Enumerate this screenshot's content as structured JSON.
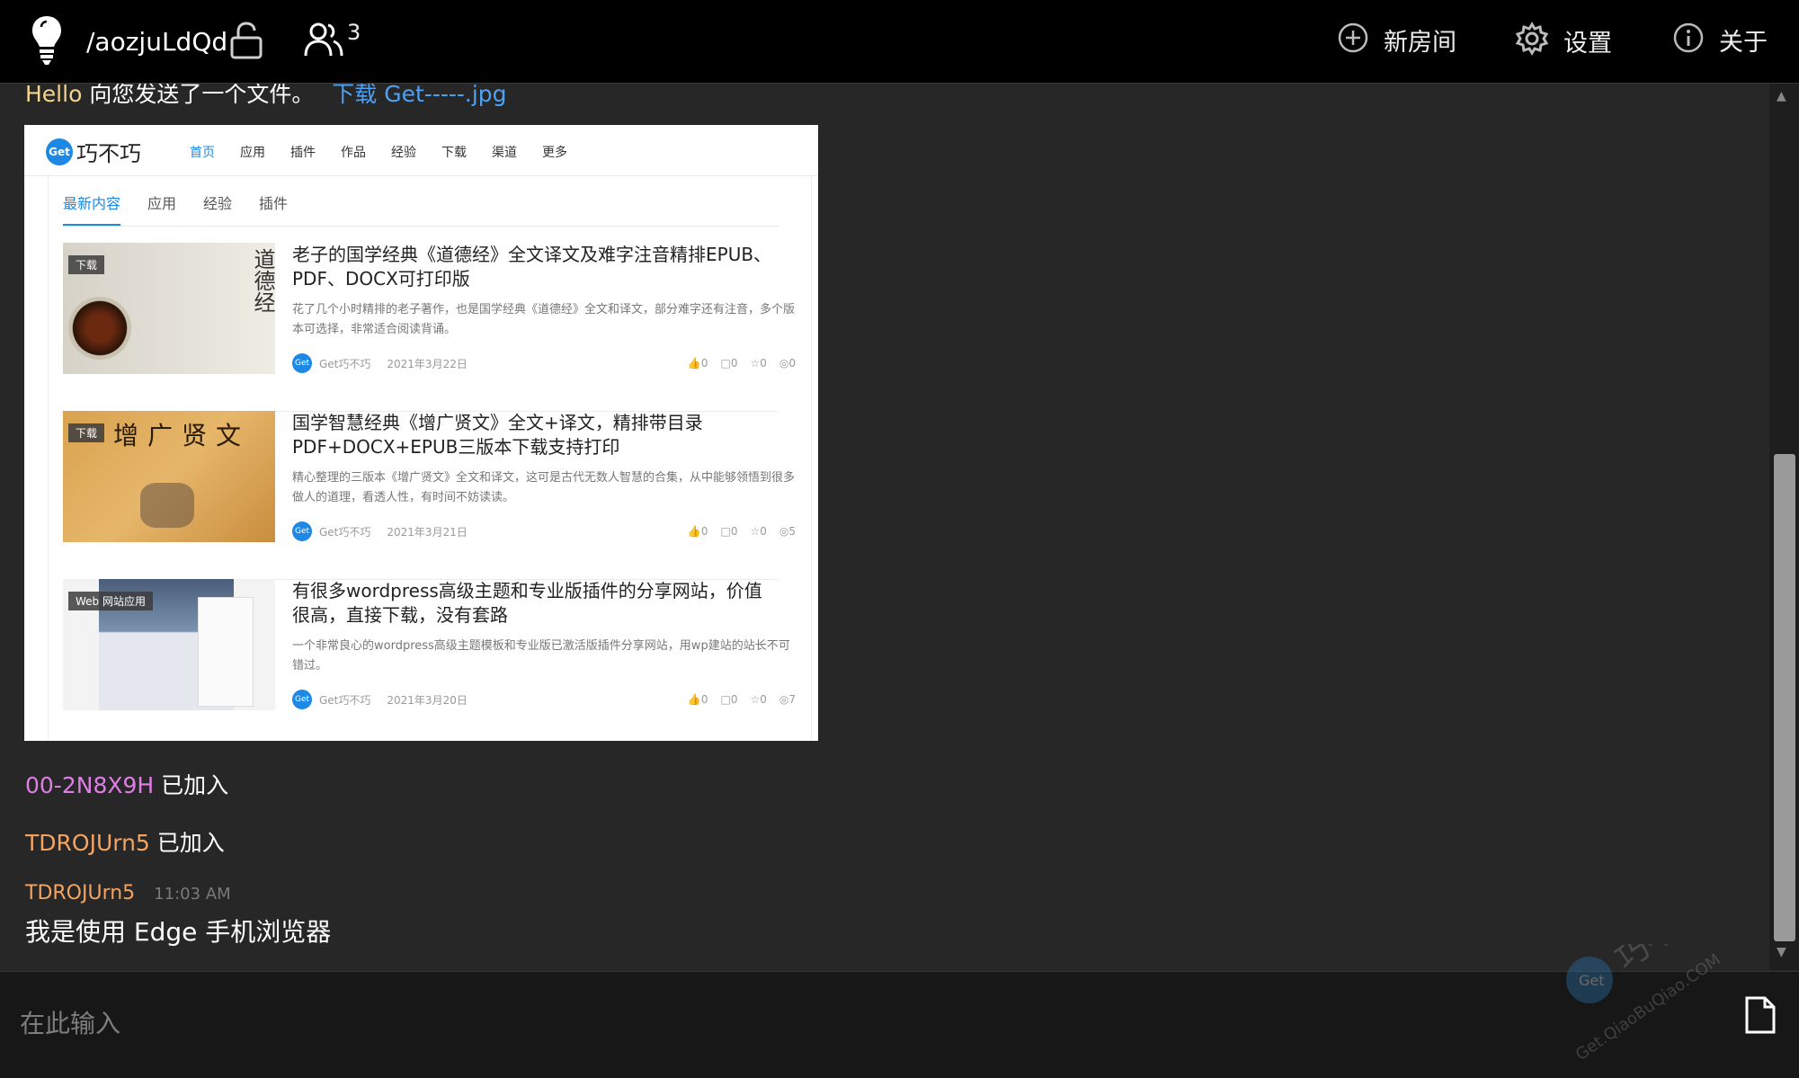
{
  "header": {
    "room_path": "/aozjuLdQd",
    "user_count": "3",
    "nav": {
      "new_room": "新房间",
      "settings": "设置",
      "about": "关于"
    }
  },
  "messages": {
    "file_msg": {
      "sender": "Hello",
      "text": "向您发送了一个文件。",
      "link": "下载 Get-----.jpg"
    },
    "joined_1": {
      "name": "00-2N8X9H",
      "text": "已加入"
    },
    "joined_2": {
      "name": "TDROJUrn5",
      "text": "已加入"
    },
    "chat_1": {
      "sender": "TDROJUrn5",
      "time": "11:03 AM",
      "text": "我是使用 Edge 手机浏览器"
    }
  },
  "shared_image": {
    "logo_badge": "Get",
    "logo_text": "巧不巧",
    "menu": [
      "首页",
      "应用",
      "插件",
      "作品",
      "经验",
      "下载",
      "渠道",
      "更多"
    ],
    "tabs": [
      "最新内容",
      "应用",
      "经验",
      "插件"
    ],
    "articles": [
      {
        "tag": "下载",
        "thumb_text": "道德经",
        "title": "老子的国学经典《道德经》全文译文及难字注音精排EPUB、PDF、DOCX可打印版",
        "summary": "花了几个小时精排的老子著作，也是国学经典《道德经》全文和译文，部分难字还有注音，多个版本可选择，非常适合阅读背诵。",
        "author": "Get巧不巧",
        "date": "2021年3月22日",
        "likes": "0",
        "comments": "0",
        "favs": "0",
        "views": "0"
      },
      {
        "tag": "下载",
        "thumb_text": "增广贤文",
        "title": "国学智慧经典《增广贤文》全文+译文，精排带目录PDF+DOCX+EPUB三版本下载支持打印",
        "summary": "精心整理的三版本《增广贤文》全文和译文，这可是古代无数人智慧的合集，从中能够领悟到很多做人的道理，看透人性，有时间不妨读读。",
        "author": "Get巧不巧",
        "date": "2021年3月21日",
        "likes": "0",
        "comments": "0",
        "favs": "0",
        "views": "5"
      },
      {
        "tag": "Web 网站应用",
        "thumb_text": "",
        "title": "有很多wordpress高级主题和专业版插件的分享网站，价值很高，直接下载，没有套路",
        "summary": "一个非常良心的wordpress高级主题模板和专业版已激活版插件分享网站，用wp建站的站长不可错过。",
        "author": "Get巧不巧",
        "date": "2021年3月20日",
        "likes": "0",
        "comments": "0",
        "favs": "0",
        "views": "7"
      }
    ]
  },
  "input": {
    "placeholder": "在此输入"
  },
  "watermark": {
    "text": "巧不巧",
    "url_text": "Get.QiaoBuQiao.COM"
  },
  "colors": {
    "accent": "#4ea1f3",
    "name_hello": "#f4d58d",
    "name_pink": "#e07ee6",
    "name_orange": "#f4a460"
  }
}
